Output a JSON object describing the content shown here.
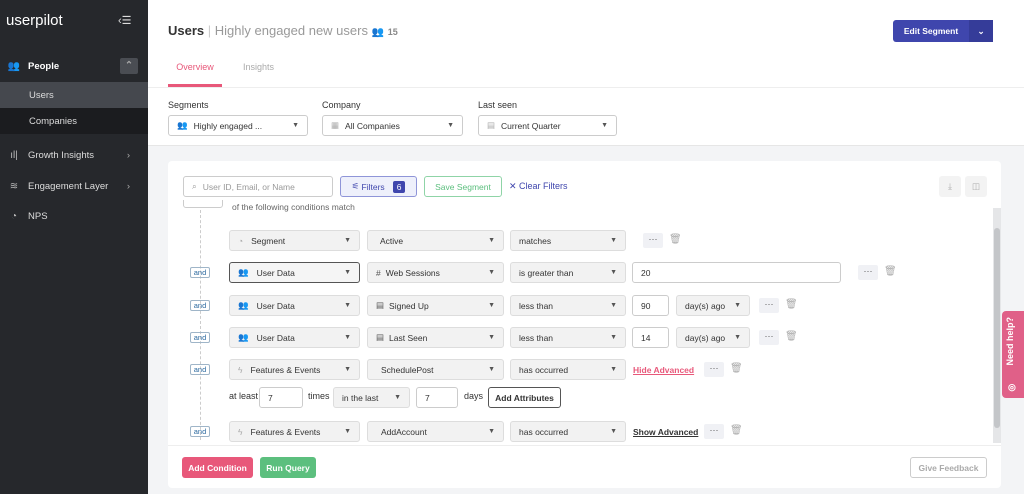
{
  "sidebar": {
    "logo": "userpilot",
    "items": [
      {
        "label": "People",
        "icon": "people-icon"
      },
      {
        "label": "Users"
      },
      {
        "label": "Companies"
      },
      {
        "label": "Growth Insights",
        "icon": "bar-chart-icon"
      },
      {
        "label": "Engagement Layer",
        "icon": "layers-icon"
      },
      {
        "label": "NPS",
        "icon": "nps-icon"
      }
    ]
  },
  "header": {
    "title": "Users",
    "segment": "Highly engaged new users",
    "count": "15",
    "edit_button": "Edit Segment",
    "tabs": [
      {
        "label": "Overview",
        "active": true
      },
      {
        "label": "Insights"
      }
    ]
  },
  "filters": {
    "segments_label": "Segments",
    "segments_value": "Highly engaged ...",
    "company_label": "Company",
    "company_value": "All Companies",
    "lastseen_label": "Last seen",
    "lastseen_value": "Current Quarter"
  },
  "toolbar": {
    "search_placeholder": "User ID, Email, or Name",
    "filters_label": "Filters",
    "filters_count": "6",
    "save_segment": "Save Segment",
    "clear_filters": "Clear Filters"
  },
  "match_text": "of the following conditions match",
  "conditions": [
    {
      "connector": "",
      "field": "Segment",
      "property": "Active",
      "operator": "matches"
    },
    {
      "connector": "and",
      "field": "User Data",
      "property": "Web Sessions",
      "operator": "is greater than",
      "value": "20"
    },
    {
      "connector": "and",
      "field": "User Data",
      "property": "Signed Up",
      "operator": "less than",
      "value": "90",
      "unit": "day(s) ago"
    },
    {
      "connector": "and",
      "field": "User Data",
      "property": "Last Seen",
      "operator": "less than",
      "value": "14",
      "unit": "day(s) ago"
    },
    {
      "connector": "and",
      "field": "Features & Events",
      "property": "SchedulePost",
      "operator": "has occurred",
      "link": "Hide Advanced"
    },
    {
      "connector": "and",
      "field": "Features & Events",
      "property": "AddAccount",
      "operator": "has occurred",
      "link": "Show Advanced"
    }
  ],
  "advanced": {
    "at_least": "at least",
    "times_value": "7",
    "times": "times",
    "range": "in the last",
    "days_value": "7",
    "days": "days",
    "add_attributes": "Add Attributes"
  },
  "footer": {
    "add_condition": "Add Condition",
    "run_query": "Run Query",
    "give_feedback": "Give Feedback"
  },
  "help_tab": "Need help?",
  "colors": {
    "accent": "#e8587a",
    "primary": "#3f46ad",
    "green": "#5cbf7e",
    "sidebar": "#26282c"
  }
}
